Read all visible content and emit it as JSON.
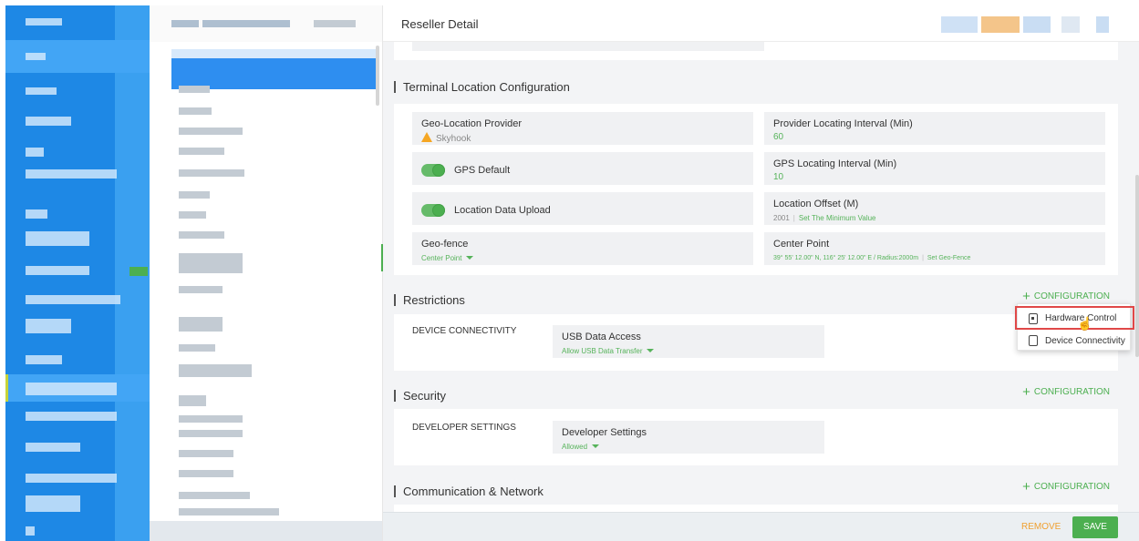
{
  "header": {
    "title": "Reseller Detail"
  },
  "sections": {
    "terminal_location": {
      "title": "Terminal Location Configuration",
      "geo_provider": {
        "label": "Geo-Location Provider",
        "value": "Skyhook"
      },
      "provider_interval": {
        "label": "Provider Locating Interval (Min)",
        "value": "60"
      },
      "gps_default": {
        "label": "GPS Default",
        "on": true
      },
      "gps_interval": {
        "label": "GPS Locating Interval (Min)",
        "value": "10"
      },
      "location_upload": {
        "label": "Location Data Upload",
        "on": true
      },
      "location_offset": {
        "label": "Location Offset (M)",
        "value": "2001",
        "link": "Set The Minimum Value"
      },
      "geo_fence": {
        "label": "Geo-fence",
        "value": "Center Point"
      },
      "center_point": {
        "label": "Center Point",
        "value": "39° 55' 12.00\" N, 116° 25' 12.00\" E / Radius:2000m",
        "link": "Set Geo-Fence"
      }
    },
    "restrictions": {
      "title": "Restrictions",
      "configuration_label": "CONFIGURATION",
      "category": "DEVICE CONNECTIVITY",
      "field": {
        "label": "USB Data Access",
        "value": "Allow USB Data Transfer"
      }
    },
    "security": {
      "title": "Security",
      "configuration_label": "CONFIGURATION",
      "category": "DEVELOPER SETTINGS",
      "field": {
        "label": "Developer Settings",
        "value": "Allowed"
      }
    },
    "communication": {
      "title": "Communication & Network",
      "configuration_label": "CONFIGURATION"
    }
  },
  "dropdown": {
    "options": [
      {
        "label": "Hardware Control",
        "icon": "chip-icon"
      },
      {
        "label": "Device Connectivity",
        "icon": "phone-icon"
      }
    ]
  },
  "footer": {
    "remove_label": "REMOVE",
    "save_label": "SAVE"
  },
  "colors": {
    "accent_green": "#4caf50",
    "sidebar_blue": "#1e88e5",
    "warning": "#f5a623",
    "highlight_red": "#e04848"
  }
}
